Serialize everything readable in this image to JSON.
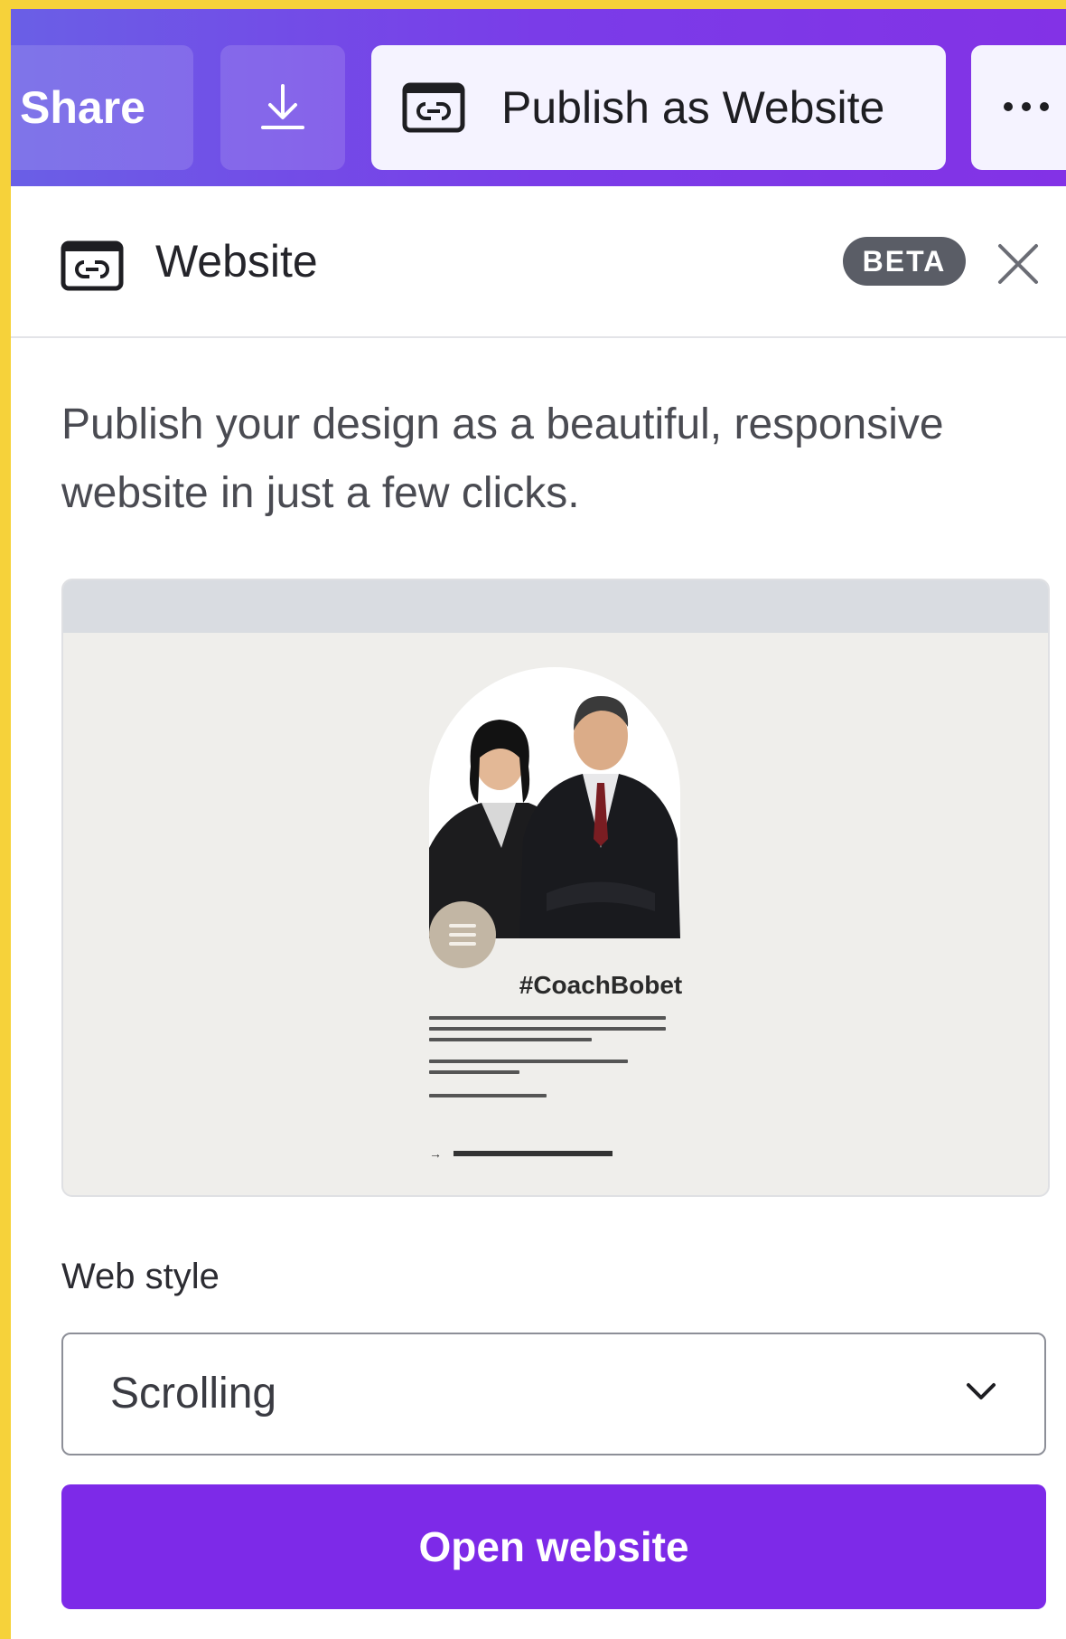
{
  "toolbar": {
    "share_label": "Share",
    "download_icon": "download-icon",
    "publish_label": "Publish as Website",
    "publish_icon": "website-link-icon",
    "more_icon": "more-dots-icon"
  },
  "panel": {
    "title": "Website",
    "title_icon": "website-link-icon",
    "badge": "BETA",
    "close_icon": "close-icon",
    "description": "Publish your design as a beautiful, responsive website in just a few clicks."
  },
  "preview": {
    "heading": "#CoachBobet",
    "image": "coaches-photo"
  },
  "web_style": {
    "label": "Web style",
    "selected": "Scrolling"
  },
  "actions": {
    "open_website_label": "Open website"
  },
  "colors": {
    "topbar_gradient_start": "#6a5fe6",
    "topbar_gradient_end": "#8332e6",
    "primary_button": "#7d2ae8",
    "beta_badge": "#5a5d66",
    "window_border": "#f6d23a"
  }
}
